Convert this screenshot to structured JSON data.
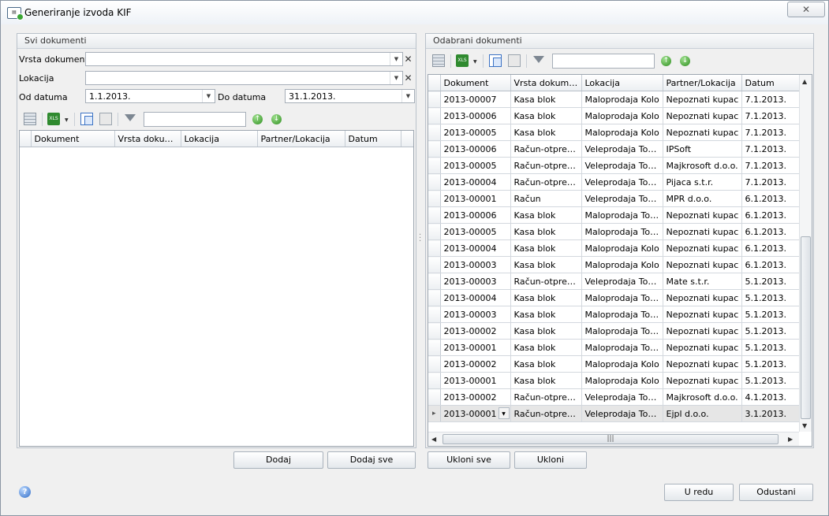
{
  "window": {
    "title": "Generiranje izvoda KIF",
    "close_glyph": "✕"
  },
  "left_panel": {
    "header": "Svi dokumenti",
    "vrsta_label": "Vrsta dokumenta",
    "vrsta_value": "",
    "lokacija_label": "Lokacija",
    "lokacija_value": "",
    "od_label": "Od datuma",
    "od_value": "1.1.2013.",
    "do_label": "Do datuma",
    "do_value": "31.1.2013.",
    "search_value": "",
    "columns": [
      "Dokument",
      "Vrsta dokume...",
      "Lokacija",
      "Partner/Lokacija",
      "Datum"
    ]
  },
  "right_panel": {
    "header": "Odabrani dokumenti",
    "search_value": "",
    "columns": [
      "Dokument",
      "Vrsta dokumenta",
      "Lokacija",
      "Partner/Lokacija",
      "Datum"
    ],
    "rows": [
      [
        "2013-00007",
        "Kasa blok",
        "Maloprodaja Kolo",
        "Nepoznati kupac",
        "7.1.2013."
      ],
      [
        "2013-00006",
        "Kasa blok",
        "Maloprodaja Kolo",
        "Nepoznati kupac",
        "7.1.2013."
      ],
      [
        "2013-00005",
        "Kasa blok",
        "Maloprodaja Kolo",
        "Nepoznati kupac",
        "7.1.2013."
      ],
      [
        "2013-00006",
        "Račun-otprem...",
        "Veleprodaja Tomi...",
        "IPSoft",
        "7.1.2013."
      ],
      [
        "2013-00005",
        "Račun-otprem...",
        "Veleprodaja Tomi...",
        "Majkrosoft d.o.o.",
        "7.1.2013."
      ],
      [
        "2013-00004",
        "Račun-otprem...",
        "Veleprodaja Tomi...",
        "Pijaca s.t.r.",
        "7.1.2013."
      ],
      [
        "2013-00001",
        "Račun",
        "Veleprodaja Tomi...",
        "MPR d.o.o.",
        "6.1.2013."
      ],
      [
        "2013-00006",
        "Kasa blok",
        "Maloprodaja Tomi...",
        "Nepoznati kupac",
        "6.1.2013."
      ],
      [
        "2013-00005",
        "Kasa blok",
        "Maloprodaja Tomi...",
        "Nepoznati kupac",
        "6.1.2013."
      ],
      [
        "2013-00004",
        "Kasa blok",
        "Maloprodaja Kolo",
        "Nepoznati kupac",
        "6.1.2013."
      ],
      [
        "2013-00003",
        "Kasa blok",
        "Maloprodaja Kolo",
        "Nepoznati kupac",
        "6.1.2013."
      ],
      [
        "2013-00003",
        "Račun-otprem...",
        "Veleprodaja Tomi...",
        "Mate s.t.r.",
        "5.1.2013."
      ],
      [
        "2013-00004",
        "Kasa blok",
        "Maloprodaja Tomi...",
        "Nepoznati kupac",
        "5.1.2013."
      ],
      [
        "2013-00003",
        "Kasa blok",
        "Maloprodaja Tomi...",
        "Nepoznati kupac",
        "5.1.2013."
      ],
      [
        "2013-00002",
        "Kasa blok",
        "Maloprodaja Tomi...",
        "Nepoznati kupac",
        "5.1.2013."
      ],
      [
        "2013-00001",
        "Kasa blok",
        "Maloprodaja Tomi...",
        "Nepoznati kupac",
        "5.1.2013."
      ],
      [
        "2013-00002",
        "Kasa blok",
        "Maloprodaja Kolo",
        "Nepoznati kupac",
        "5.1.2013."
      ],
      [
        "2013-00001",
        "Kasa blok",
        "Maloprodaja Kolo",
        "Nepoznati kupac",
        "5.1.2013."
      ],
      [
        "2013-00002",
        "Račun-otprem...",
        "Veleprodaja Tomi...",
        "Majkrosoft d.o.o.",
        "4.1.2013."
      ],
      [
        "2013-00001",
        "Račun-otprem...",
        "Veleprodaja Tomi...",
        "Ejpl d.o.o.",
        "3.1.2013."
      ]
    ],
    "current_row": 19
  },
  "buttons": {
    "dodaj": "Dodaj",
    "dodaj_sve": "Dodaj sve",
    "ukloni_sve": "Ukloni sve",
    "ukloni": "Ukloni",
    "ok": "U redu",
    "cancel": "Odustani"
  },
  "icons": {
    "help": "?",
    "xls": "XLS",
    "up": "↑",
    "down": "↓",
    "hscroll_grip": "|||"
  }
}
